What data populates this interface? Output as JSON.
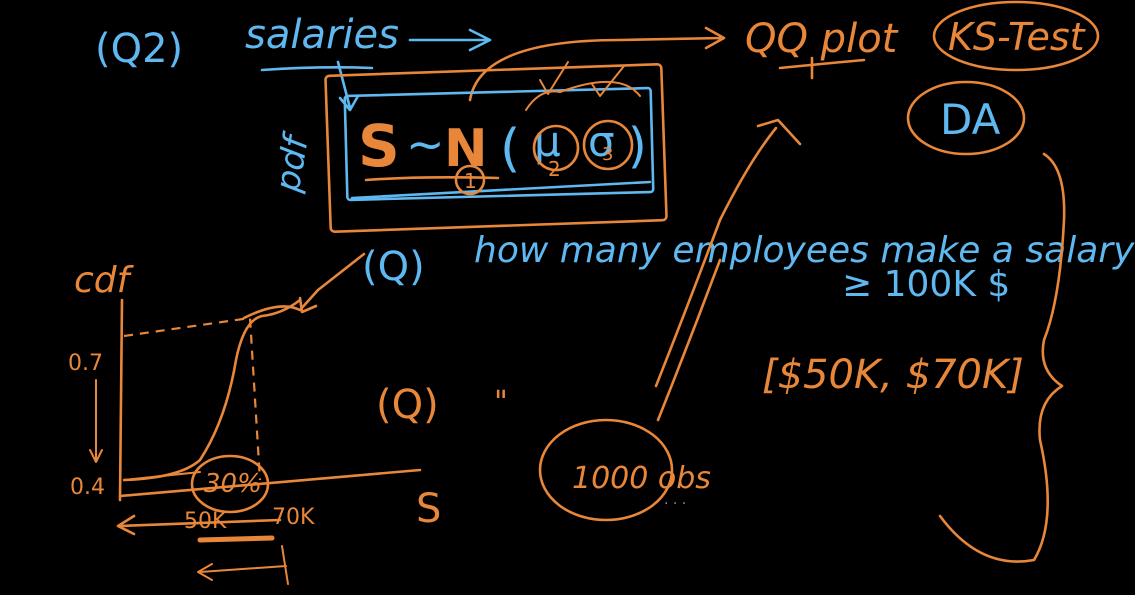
{
  "board": {
    "background": "#000000",
    "ink_blue": "#5fb8f0",
    "ink_orange": "#e8873a",
    "ink_grey": "#8a8f96"
  },
  "top": {
    "q2": "(Q2)",
    "salaries": "salaries",
    "qq_plot": "QQ plot",
    "ks_test": "KS-Test",
    "da": "DA"
  },
  "formula": {
    "pdf": "pdf",
    "s": "S",
    "tilde": "~",
    "n": "N",
    "open_paren": "(",
    "mu": "μ",
    "sigma": "σ",
    "close_paren": ")",
    "num1": "1",
    "num2": "2",
    "num3": "3"
  },
  "question": {
    "q": "(Q)",
    "text": "how many employees make a salary",
    "threshold": "≥ 100K $",
    "range": "[$50K, $70K]"
  },
  "graph": {
    "ylabel": "cdf",
    "y_high": "0.7",
    "y_low": "0.4",
    "percent": "30%",
    "x_left": "50K",
    "x_right": "70K",
    "xlabel": "S"
  },
  "middle": {
    "q": "(Q)",
    "ditto": "\""
  },
  "sample": {
    "label": "1000 obs"
  }
}
